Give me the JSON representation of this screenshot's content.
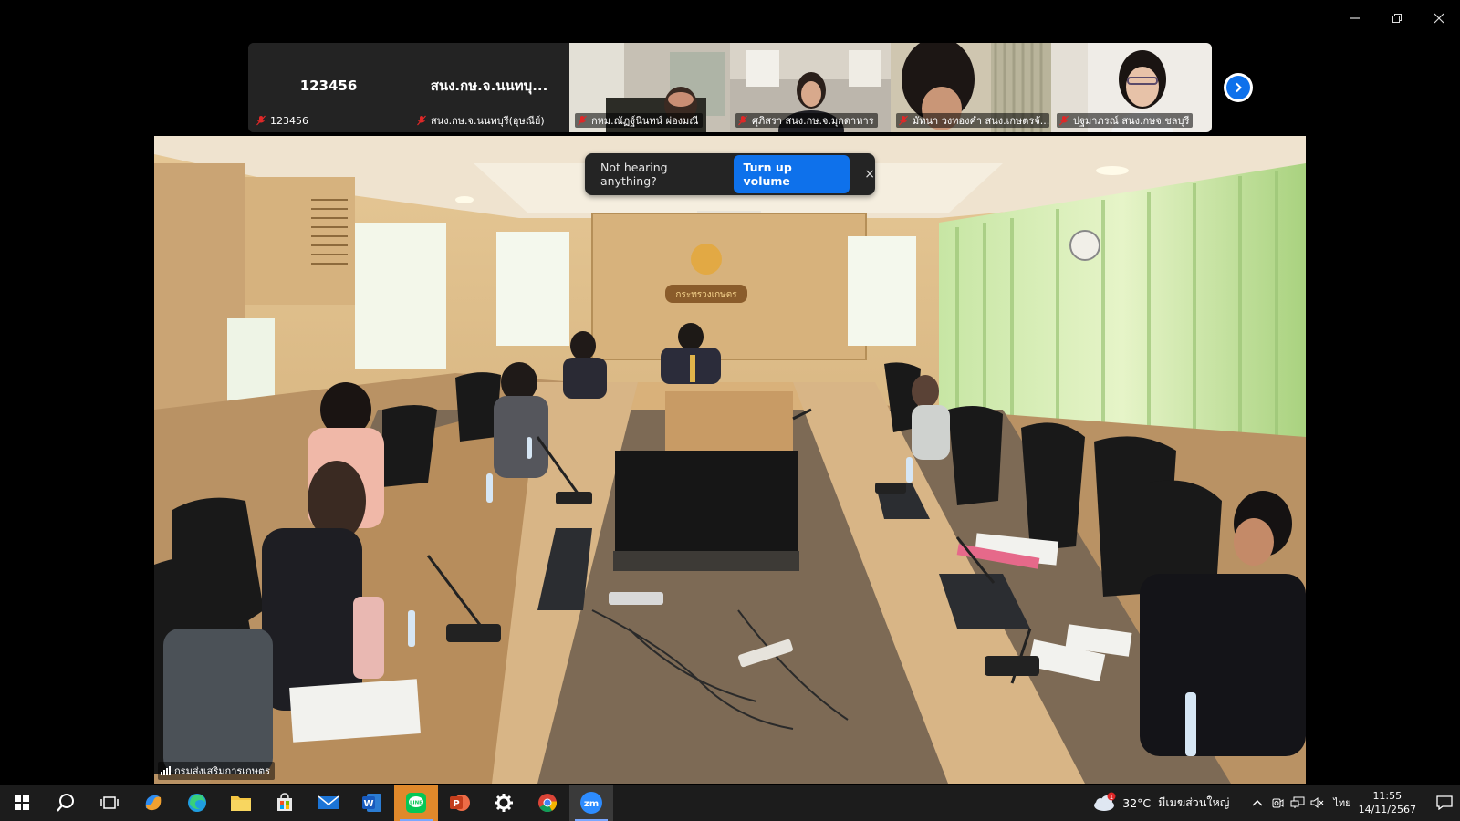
{
  "participants": [
    {
      "display_name": "123456",
      "label": "123456"
    },
    {
      "display_name": "สนง.กษ.จ.นนทบุ...",
      "label": "สนง.กษ.จ.นนทบุรี(อุษณีย์)"
    },
    {
      "display_name": "",
      "label": "กหม.ณัฏฐ์นินทน์ ผ่องมณี"
    },
    {
      "display_name": "",
      "label": "ศุภิสรา สนง.กษ.จ.มุกดาหาร"
    },
    {
      "display_name": "",
      "label": "มัทนา วงทองคำ สนง.เกษตรจั..."
    },
    {
      "display_name": "",
      "label": "ปฐมาภรณ์ สนง.กษจ.ชลบุรี"
    }
  ],
  "main_video": {
    "speaker_label": "กรมส่งเสริมการเกษตร",
    "room_sign": "กระทรวงเกษตร"
  },
  "toast": {
    "message": "Not hearing anything?",
    "button_label": "Turn up volume",
    "close_glyph": "×"
  },
  "taskbar": {
    "weather_temp": "32°C",
    "weather_location": "มีเมฆส่วนใหญ่",
    "weather_badge": "1",
    "language": "ไทย",
    "time": "11:55",
    "date": "14/11/2567"
  },
  "colors": {
    "zoom_blue": "#0e71eb",
    "mic_muted": "#e02828",
    "strip_bg": "#232323",
    "taskbar_bg": "#1c1c1c"
  }
}
